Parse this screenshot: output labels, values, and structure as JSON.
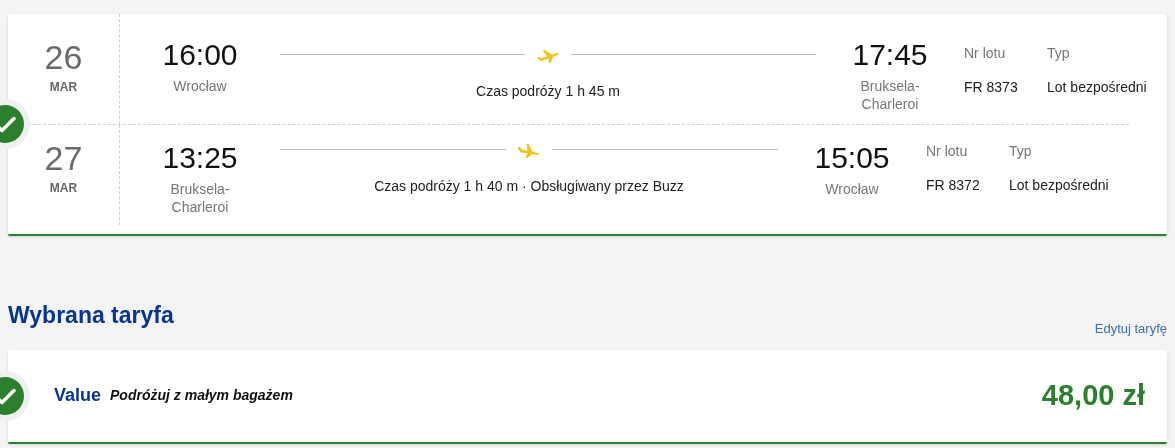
{
  "flights_card": {
    "selected": true,
    "flights": [
      {
        "kind": "outbound",
        "day": "26",
        "month": "MAR",
        "departure_time": "16:00",
        "departure_city": "Wrocław",
        "duration": "Czas podróży 1 h 45 m",
        "arrival_time": "17:45",
        "arrival_city": "Bruksela-Charleroi",
        "flight_no_label": "Nr lotu",
        "flight_no": "FR 8373",
        "type_label": "Typ",
        "type": "Lot bezpośredni"
      },
      {
        "kind": "return",
        "day": "27",
        "month": "MAR",
        "departure_time": "13:25",
        "departure_city": "Bruksela-Charleroi",
        "duration": "Czas podróży 1 h 40 m · Obsługiwany przez Buzz",
        "arrival_time": "15:05",
        "arrival_city": "Wrocław",
        "flight_no_label": "Nr lotu",
        "flight_no": "FR 8372",
        "type_label": "Typ",
        "type": "Lot bezpośredni"
      }
    ]
  },
  "fare_section": {
    "title": "Wybrana taryfa",
    "edit_link": "Edytuj taryfę",
    "fare": {
      "selected": true,
      "name": "Value",
      "description": "Podróżuj z małym bagażem",
      "price": "48,00 zł"
    }
  }
}
